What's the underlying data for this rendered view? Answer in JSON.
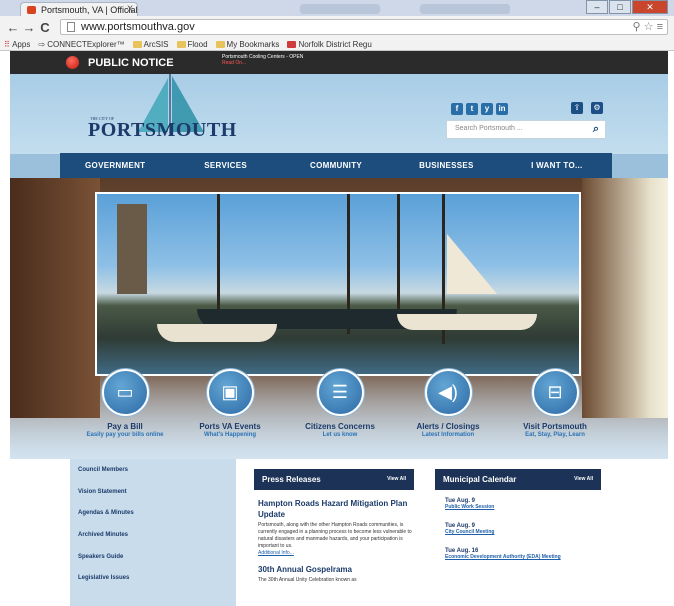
{
  "browser": {
    "tab_title": "Portsmouth, VA | Official",
    "tab_close": "X",
    "back": "←",
    "forward": "→",
    "reload": "C",
    "url": "www.portsmouthva.gov",
    "tools": "⚲ ☆ ≡",
    "bookmarks": [
      "Apps",
      "CONNECTExplorer™",
      "ArcSIS",
      "Flood",
      "My Bookmarks",
      "Norfolk District Regu"
    ]
  },
  "notice": {
    "label": "PUBLIC NOTICE",
    "ticker": "Portsmouth Cooling Centers - OPEN",
    "ticker_sub": "Read On..."
  },
  "header": {
    "logo_small": "THE CITY OF",
    "logo_name": "PORTSMOUTH",
    "search_placeholder": "Search Portsmouth ...",
    "socials": [
      "f",
      "t",
      "y",
      "in"
    ]
  },
  "nav": [
    "GOVERNMENT",
    "SERVICES",
    "COMMUNITY",
    "BUSINESSES",
    "I WANT TO..."
  ],
  "quick_links": [
    {
      "title": "Pay a Bill",
      "sub": "Easily pay your bills online",
      "icon": "credit-card-icon",
      "glyph": "▭"
    },
    {
      "title": "Ports VA Events",
      "sub": "What's Happening",
      "icon": "picture-icon",
      "glyph": "▣"
    },
    {
      "title": "Citizens Concerns",
      "sub": "Let us know",
      "icon": "chat-icon",
      "glyph": "☰"
    },
    {
      "title": "Alerts / Closings",
      "sub": "Latest Information",
      "icon": "megaphone-icon",
      "glyph": "◀)"
    },
    {
      "title": "Visit Portsmouth",
      "sub": "Eat, Stay, Play, Learn",
      "icon": "briefcase-icon",
      "glyph": "⊟"
    }
  ],
  "sidebar": [
    "Council Members",
    "Vision Statement",
    "Agendas & Minutes",
    "Archived Minutes",
    "Speakers Guide",
    "Legislative Issues"
  ],
  "press": {
    "heading": "Press Releases",
    "view_all": "View All",
    "items": [
      {
        "title": "Hampton Roads Hazard Mitigation Plan Update",
        "body": "Portsmouth, along with the other Hampton Roads communities, is currently engaged in a planning process to become less vulnerable to natural disasters and manmade hazards, and your participation is important to us.",
        "link": "Additional Info..."
      },
      {
        "title": "30th Annual Gospelrama",
        "body": "The 30th Annual Unity Celebration known as"
      }
    ]
  },
  "calendar": {
    "heading": "Municipal Calendar",
    "view_all": "View All",
    "items": [
      {
        "date": "Tue Aug. 9",
        "event": "Public Work Session"
      },
      {
        "date": "Tue Aug. 9",
        "event": "City Council Meeting"
      },
      {
        "date": "Tue Aug. 16",
        "event": "Economic Development Authority (EDA) Meeting"
      }
    ]
  }
}
